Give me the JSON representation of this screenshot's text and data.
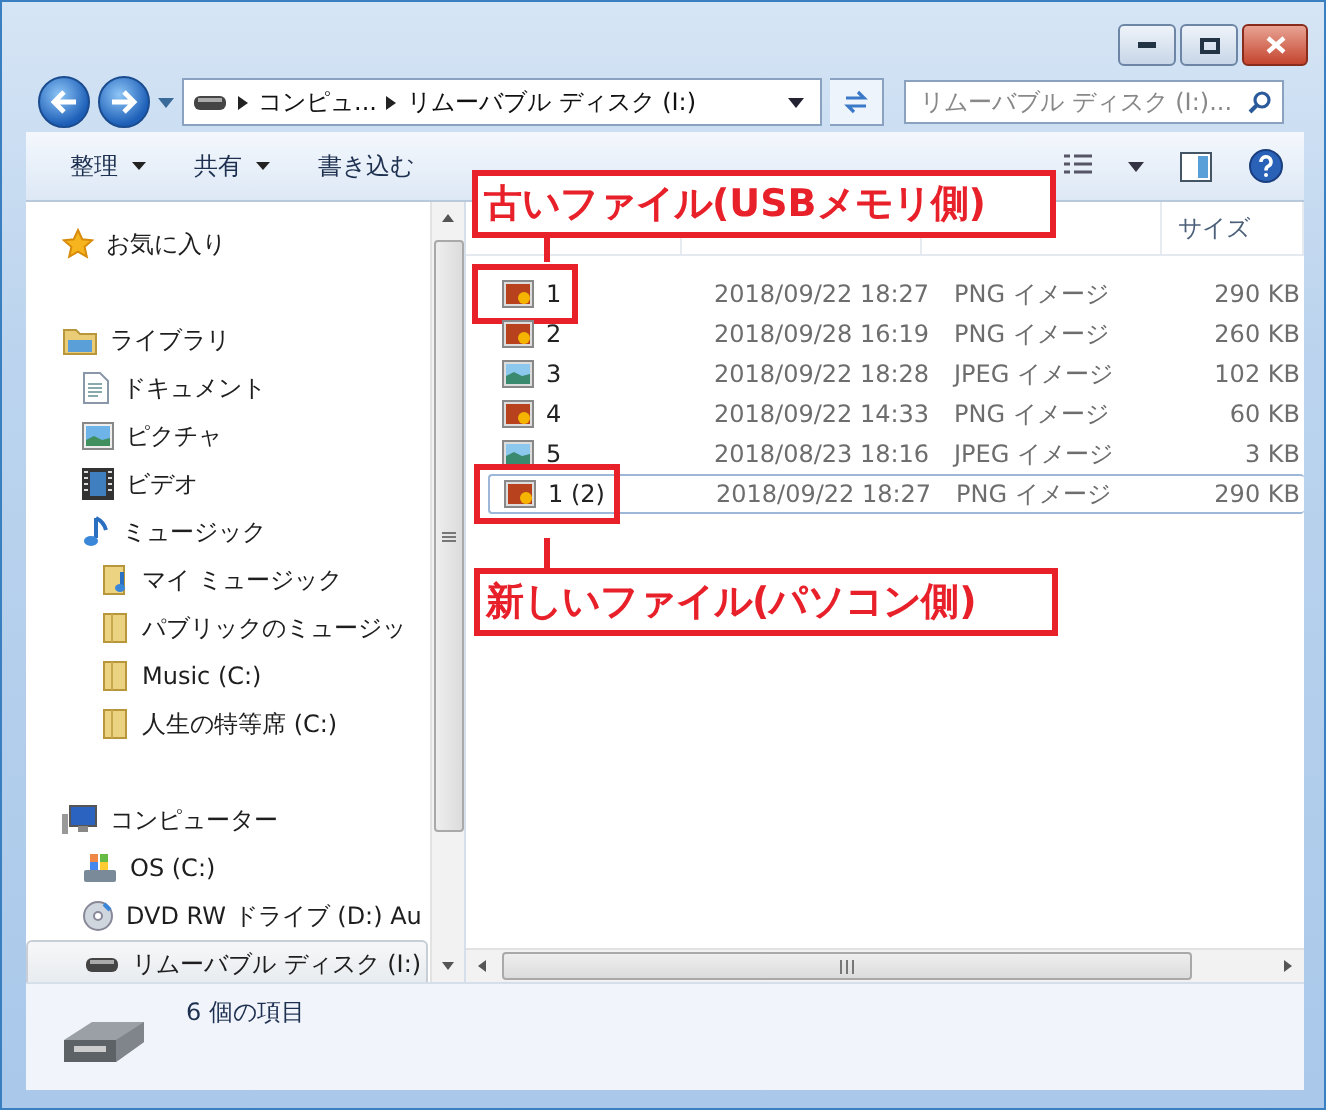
{
  "navigation": {
    "breadcrumbs": [
      "コンピュ...",
      "リムーバブル ディスク (I:)"
    ],
    "search": {
      "placeholder": "リムーバブル ディスク (I:)..."
    }
  },
  "toolbar": {
    "items": [
      {
        "label": "整理",
        "dropdown": true
      },
      {
        "label": "共有",
        "dropdown": true
      },
      {
        "label": "書き込む",
        "dropdown": false
      }
    ]
  },
  "sidebar": {
    "groups": [
      {
        "label": "お気に入り",
        "kind": "favorites",
        "selected": false
      },
      {
        "label": "ライブラリ",
        "kind": "library",
        "selected": false,
        "children": [
          {
            "label": "ドキュメント",
            "kind": "document",
            "selected": false
          },
          {
            "label": "ピクチャ",
            "kind": "picture",
            "selected": false
          },
          {
            "label": "ビデオ",
            "kind": "video",
            "selected": false
          },
          {
            "label": "ミュージック",
            "kind": "music",
            "selected": false,
            "children": [
              {
                "label": "マイ ミュージック",
                "kind": "music-folder",
                "selected": false
              },
              {
                "label": "パブリックのミュージッ",
                "kind": "folder",
                "selected": false
              },
              {
                "label": "Music (C:)",
                "kind": "folder",
                "selected": false
              },
              {
                "label": "人生の特等席 (C:)",
                "kind": "folder",
                "selected": false
              }
            ]
          }
        ]
      },
      {
        "label": "コンピューター",
        "kind": "computer",
        "selected": false,
        "children": [
          {
            "label": "OS (C:)",
            "kind": "os-drive",
            "selected": false
          },
          {
            "label": "DVD RW ドライブ (D:) Au",
            "kind": "dvd",
            "selected": false
          },
          {
            "label": "リムーバブル ディスク (I:)",
            "kind": "usb-drive",
            "selected": true
          }
        ]
      }
    ]
  },
  "table": {
    "columns": [
      "サイズ"
    ],
    "rows": [
      {
        "name": "1",
        "date": "2018/09/22 18:27",
        "type": "PNG イメージ",
        "size": "290 KB",
        "kind": "png",
        "highlighted": true,
        "focused": false
      },
      {
        "name": "2",
        "date": "2018/09/28 16:19",
        "type": "PNG イメージ",
        "size": "260 KB",
        "kind": "png",
        "highlighted": false,
        "focused": false
      },
      {
        "name": "3",
        "date": "2018/09/22 18:28",
        "type": "JPEG イメージ",
        "size": "102 KB",
        "kind": "jpeg",
        "highlighted": false,
        "focused": false
      },
      {
        "name": "4",
        "date": "2018/09/22 14:33",
        "type": "PNG イメージ",
        "size": "60 KB",
        "kind": "png",
        "highlighted": false,
        "focused": false
      },
      {
        "name": "5",
        "date": "2018/08/23 18:16",
        "type": "JPEG イメージ",
        "size": "3 KB",
        "kind": "jpeg",
        "highlighted": false,
        "focused": false
      },
      {
        "name": "1 (2)",
        "date": "2018/09/22 18:27",
        "type": "PNG イメージ",
        "size": "290 KB",
        "kind": "png",
        "highlighted": true,
        "focused": true
      }
    ]
  },
  "status_bar": {
    "text": "6 個の項目"
  },
  "callouts": [
    {
      "text": "古いファイル(USBメモリ側)",
      "kind": "above"
    },
    {
      "text": "新しいファイル(パソコン側)",
      "kind": "below"
    }
  ]
}
